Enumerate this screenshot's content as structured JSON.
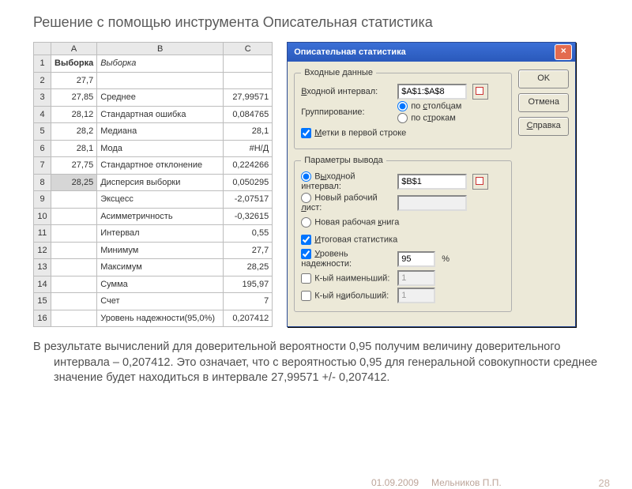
{
  "title": "Решение с помощью инструмента Описательная статистика",
  "spreadsheet": {
    "columns": [
      "",
      "A",
      "B",
      "C"
    ],
    "rows": [
      {
        "n": "1",
        "a": "Выборка",
        "b": "Выборка",
        "c": ""
      },
      {
        "n": "2",
        "a": "27,7",
        "b": "",
        "c": ""
      },
      {
        "n": "3",
        "a": "27,85",
        "b": "Среднее",
        "c": "27,99571"
      },
      {
        "n": "4",
        "a": "28,12",
        "b": "Стандартная ошибка",
        "c": "0,084765"
      },
      {
        "n": "5",
        "a": "28,2",
        "b": "Медиана",
        "c": "28,1"
      },
      {
        "n": "6",
        "a": "28,1",
        "b": "Мода",
        "c": "#Н/Д"
      },
      {
        "n": "7",
        "a": "27,75",
        "b": "Стандартное отклонение",
        "c": "0,224266"
      },
      {
        "n": "8",
        "a": "28,25",
        "b": "Дисперсия выборки",
        "c": "0,050295"
      },
      {
        "n": "9",
        "a": "",
        "b": "Эксцесс",
        "c": "-2,07517"
      },
      {
        "n": "10",
        "a": "",
        "b": "Асимметричность",
        "c": "-0,32615"
      },
      {
        "n": "11",
        "a": "",
        "b": "Интервал",
        "c": "0,55"
      },
      {
        "n": "12",
        "a": "",
        "b": "Минимум",
        "c": "27,7"
      },
      {
        "n": "13",
        "a": "",
        "b": "Максимум",
        "c": "28,25"
      },
      {
        "n": "14",
        "a": "",
        "b": "Сумма",
        "c": "195,97"
      },
      {
        "n": "15",
        "a": "",
        "b": "Счет",
        "c": "7"
      },
      {
        "n": "16",
        "a": "",
        "b": "Уровень надежности(95,0%)",
        "c": "0,207412"
      }
    ]
  },
  "dialog": {
    "title": "Описательная статистика",
    "buttons": {
      "ok": "OK",
      "cancel": "Отмена",
      "help": "Справка"
    },
    "input": {
      "legend": "Входные данные",
      "range_label": "Входной интервал:",
      "range_val": "$A$1:$A$8",
      "group_label": "Группирование:",
      "by_cols": "по столбцам",
      "by_rows": "по строкам",
      "labels": "Метки в первой строке"
    },
    "output": {
      "legend": "Параметры вывода",
      "out_range": "Выходной интервал:",
      "out_val": "$B$1",
      "new_ws": "Новый рабочий лист:",
      "new_wb": "Новая рабочая книга",
      "summary": "Итоговая статистика",
      "conf": "Уровень надежности:",
      "conf_val": "95",
      "pct": "%",
      "kth_small": "К-ый наименьший:",
      "kth_large": "К-ый наибольший:",
      "one": "1"
    }
  },
  "body_text": "В результате вычислений для доверительной вероятности 0,95 получим величину доверительного интервала – 0,207412. Это означает, что с вероятностью 0,95 для генеральной совокупности среднее значение будет находиться в интервале 27,99571 +/- 0,207412.",
  "footer": {
    "date": "01.09.2009",
    "author": "Мельников П.П.",
    "page": "28"
  }
}
